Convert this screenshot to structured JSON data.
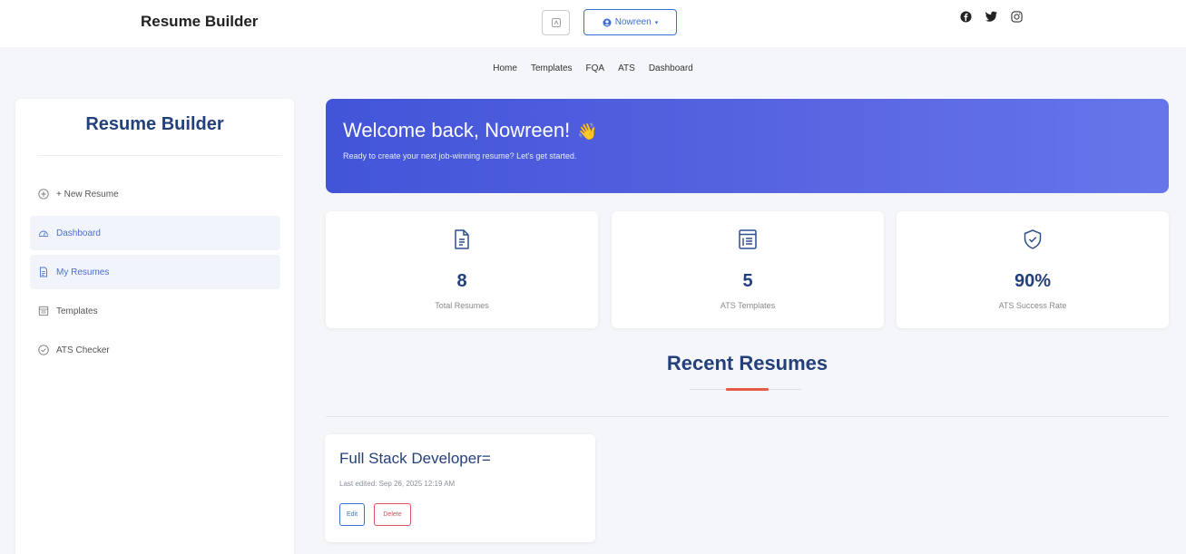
{
  "header": {
    "brand": "Resume Builder",
    "theme_toggle_icon": "theme-toggle-icon",
    "user_menu": {
      "label": "Nowreen",
      "icon": "user-circle-icon",
      "caret": "chevron-down-icon"
    },
    "socials": [
      "facebook-icon",
      "twitter-icon",
      "instagram-icon"
    ]
  },
  "nav": {
    "links": [
      "Home",
      "Templates",
      "FQA",
      "ATS",
      "Dashboard"
    ]
  },
  "sidebar": {
    "title": "Resume Builder",
    "items": [
      {
        "label": "+ New Resume",
        "icon": "plus-circle-icon",
        "active": false
      },
      {
        "label": "Dashboard",
        "icon": "dashboard-icon",
        "active": true
      },
      {
        "label": "My Resumes",
        "icon": "document-icon",
        "active": true
      },
      {
        "label": "Templates",
        "icon": "template-icon",
        "active": false
      },
      {
        "label": "ATS Checker",
        "icon": "check-circle-icon",
        "active": false
      }
    ]
  },
  "welcome": {
    "title": "Welcome back, Nowreen!",
    "emoji": "👋",
    "subtitle": "Ready to create your next job-winning resume? Let's get started."
  },
  "stats": [
    {
      "value": "8",
      "label": "Total Resumes",
      "icon": "file-icon"
    },
    {
      "value": "5",
      "label": "ATS Templates",
      "icon": "template-list-icon"
    },
    {
      "value": "90%",
      "label": "ATS Success Rate",
      "icon": "shield-check-icon"
    }
  ],
  "recent": {
    "title": "Recent Resumes",
    "cards": [
      {
        "title": "Full Stack Developer=",
        "meta": "Last edited: Sep 26, 2025 12:19 AM",
        "edit_label": "Edit",
        "delete_label": "Delete"
      }
    ]
  },
  "colors": {
    "accent": "#3b6fd8",
    "heading": "#24407a",
    "banner_start": "#4254d8",
    "banner_end": "#6676ea",
    "danger": "#d8545e",
    "underline": "#e45b4a"
  }
}
